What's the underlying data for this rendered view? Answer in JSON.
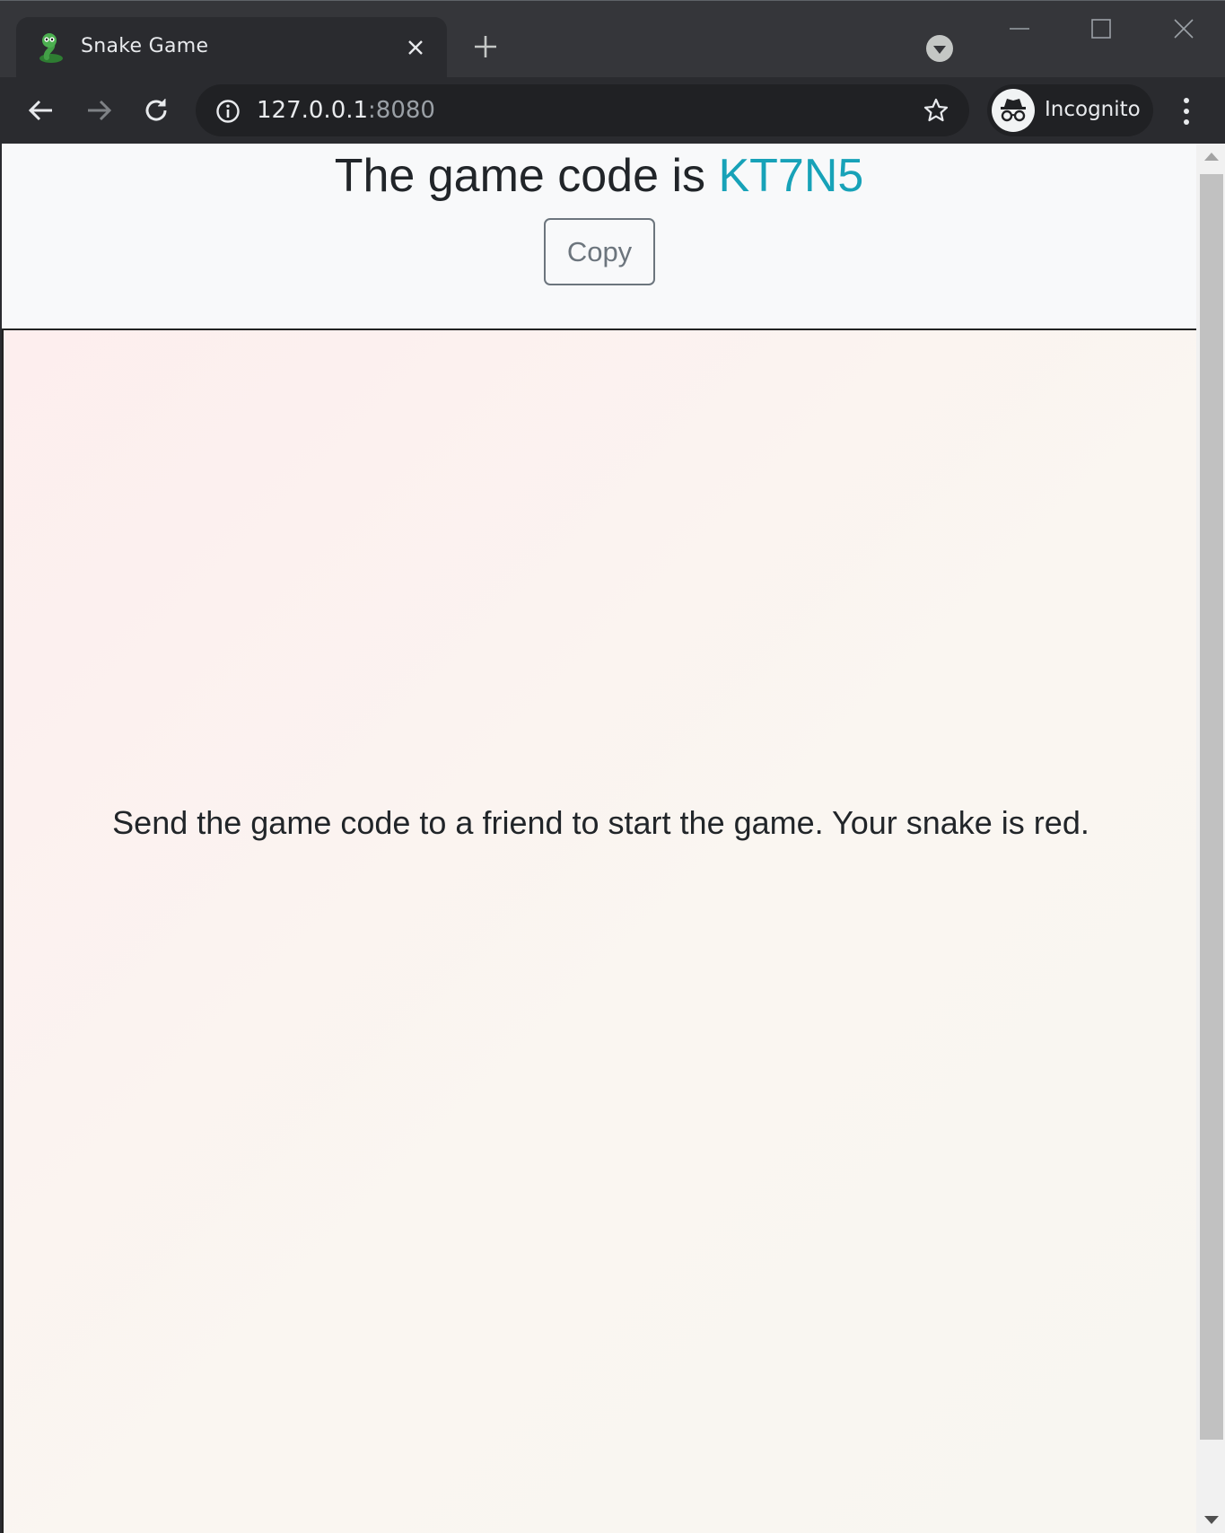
{
  "browser": {
    "tab_title": "Snake Game",
    "url_host": "127.0.0.1",
    "url_port": ":8080",
    "profile_label": "Incognito",
    "icons": [
      "snake-favicon-icon",
      "close-icon",
      "plus-icon",
      "tab-search-icon",
      "minimize-icon",
      "maximize-icon",
      "window-close-icon",
      "back-arrow-icon",
      "forward-arrow-icon",
      "reload-icon",
      "info-icon",
      "star-icon",
      "incognito-icon",
      "kebab-menu-icon"
    ]
  },
  "page": {
    "heading_prefix": "The game code is ",
    "game_code": "KT7N5",
    "copy_label": "Copy",
    "message": "Send the game code to a friend to start the game. Your snake is red.",
    "colors": {
      "code": "#17a2b8",
      "text": "#212529",
      "button_outline": "#6c757d"
    }
  }
}
